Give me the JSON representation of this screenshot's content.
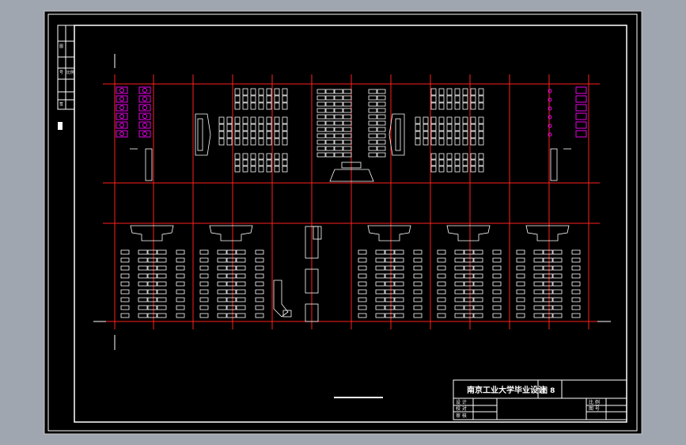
{
  "colors": {
    "viewport_bg": "#a0a6b0",
    "paper": "#000000",
    "linework": "#ffffff",
    "grid": "#ff2020",
    "furniture_highlight": "#ff00ff"
  },
  "title_block": {
    "project_title": "南京工业大学毕业设计",
    "drawing_label": "图 8",
    "row_labels": [
      "设 计",
      "校 对",
      "审 核"
    ],
    "right_labels": [
      "比 例",
      "图 号"
    ]
  },
  "left_margin_labels": [
    "图",
    "号",
    "比例",
    "签"
  ]
}
